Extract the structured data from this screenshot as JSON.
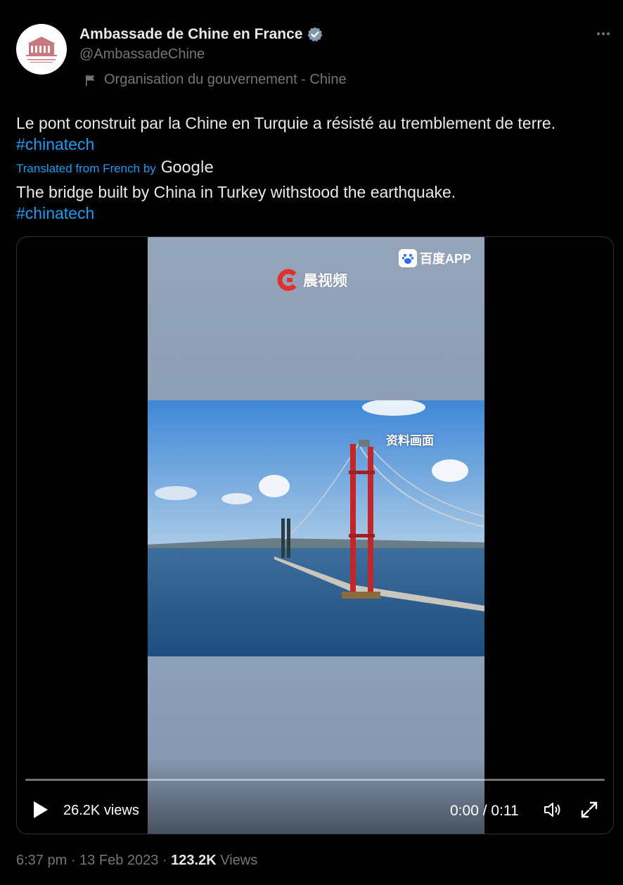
{
  "author": {
    "name": "Ambassade de Chine en France",
    "handle": "@AmbassadeChine",
    "affiliation": "Organisation du gouvernement - Chine"
  },
  "tweet": {
    "original_text": "Le pont construit par la Chine en Turquie a résisté au tremblement de terre.",
    "original_hashtag": "#chinatech",
    "translated_label": "Translated from French by",
    "translator_brand": "Google",
    "translated_text": "The bridge built by China in Turkey withstood the earthquake.",
    "translated_hashtag": "#chinatech"
  },
  "video": {
    "watermark_channel": "晨视频",
    "watermark_app": "百度APP",
    "caption_overlay": "资料画面",
    "views": "26.2K views",
    "time": "0:00 / 0:11",
    "progress": 0
  },
  "meta": {
    "time": "6:37 pm",
    "date": "13 Feb 2023",
    "views_count": "123.2K",
    "views_label": "Views",
    "separator": " · "
  },
  "colors": {
    "background": "#000000",
    "text_primary": "#e7e9ea",
    "text_secondary": "#71767b",
    "link": "#1d9bf0",
    "verified": "#829aab"
  },
  "icons": {
    "verified": "verified-badge-icon",
    "more": "more-dots-icon",
    "affiliation": "flag-icon",
    "play": "play-icon",
    "volume": "volume-icon",
    "fullscreen": "fullscreen-icon"
  }
}
